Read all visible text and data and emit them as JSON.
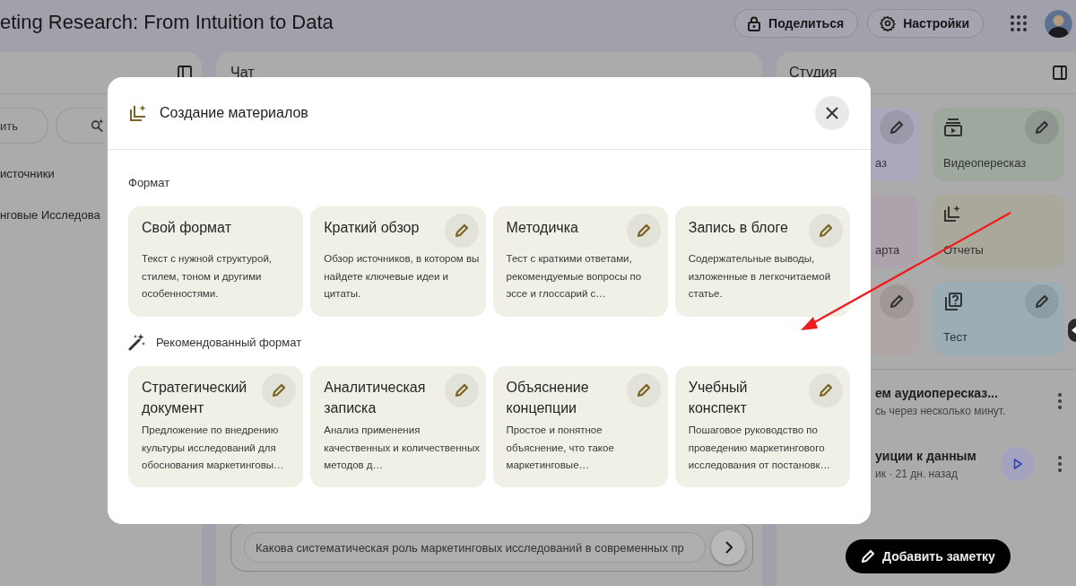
{
  "top_bar": {
    "title": "eting Research: From Intuition to Data",
    "buttons": [
      {
        "label": "Поделиться",
        "kind": "share"
      },
      {
        "label": "Настройки",
        "kind": "settings"
      }
    ]
  },
  "sources": {
    "buttons": [
      {
        "label": "ить",
        "kind": "add"
      },
      {
        "kind": "discover"
      }
    ],
    "items": [
      "источники",
      "нговые Исследова"
    ]
  },
  "chat": {
    "title": "Чат",
    "suggestion": "Какова систематическая роль маркетинговых исследований в современных пр"
  },
  "studio": {
    "title": "Студия",
    "tiles": [
      {
        "label": "аз",
        "color": "#aaa9bb",
        "editable": true
      },
      {
        "label": "Видеопересказ",
        "color": "#9ea89f",
        "kind": "video",
        "editable": true
      },
      {
        "label": "арта",
        "color": "#ada3ad",
        "editable": false
      },
      {
        "label": "Отчеты",
        "color": "#aaa79b",
        "kind": "report",
        "editable": false
      },
      {
        "color": "#b0a6a6",
        "editable": true
      },
      {
        "label": "Тест",
        "color": "#9cadb6",
        "kind": "quiz",
        "editable": true
      }
    ],
    "items": [
      {
        "title": "ем аудиопересказ...",
        "subtitle": "сь через несколько минут.",
        "kind": "pending"
      },
      {
        "title": "уиции к данным",
        "subtitle": "ик · 21 дн. назад",
        "kind": "audio"
      }
    ],
    "add_note": "Добавить заметку"
  },
  "dialog": {
    "title": "Создание материалов",
    "sections": [
      {
        "title": "Формат",
        "kind": "plain",
        "cards": [
          {
            "title": "Свой формат",
            "description": "Текст с нужной структурой, стилем, тоном и другими особенностями.",
            "editable": false
          },
          {
            "title": "Краткий обзор",
            "description": "Обзор источников, в котором вы найдете ключевые идеи и цитаты.",
            "editable": true
          },
          {
            "title": "Методичка",
            "description": "Тест с краткими ответами, рекомендуемые вопросы по эссе и глоссарий с…",
            "editable": true
          },
          {
            "title": "Запись в блоге",
            "description": "Содержательные выводы, изложенные в легкочитаемой статье.",
            "editable": true
          }
        ]
      },
      {
        "title": "Рекомендованный формат",
        "kind": "recommended",
        "cards": [
          {
            "title": "Стратегический документ",
            "description": "Предложение по внедрению культуры исследований для обоснования маркетинговы…",
            "editable": true
          },
          {
            "title": "Аналитическая записка",
            "description": "Анализ применения качественных и количественных методов д…",
            "editable": true
          },
          {
            "title": "Объяснение концепции",
            "description": "Простое и понятное объяснение, что такое маркетинговые…",
            "editable": true
          },
          {
            "title": "Учебный конспект",
            "description": "Пошаговое руководство по проведению маркетингового исследования от постановк…",
            "editable": true
          }
        ]
      }
    ]
  },
  "annotation": {
    "kind": "arrow"
  }
}
